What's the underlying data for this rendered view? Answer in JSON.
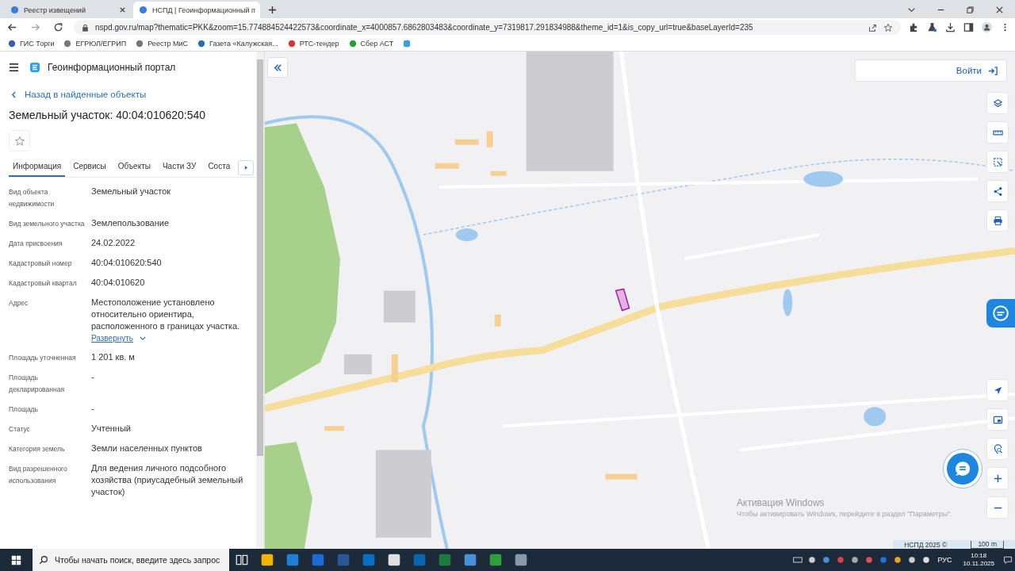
{
  "browser": {
    "tabs": [
      {
        "title": "Реестр извещений",
        "selected": false
      },
      {
        "title": "НСПД | Геоинформационный п",
        "selected": true
      }
    ],
    "url": "nspd.gov.ru/map?thematic=PKK&zoom=15.774884524422573&coordinate_x=4000857.6862803483&coordinate_y=7319817.291834988&theme_id=1&is_copy_url=true&baseLayerId=235",
    "bookmarks": [
      "ГИС Торги",
      "ЕГРЮЛ/ЕГРИП",
      "Реестр МиС",
      "Газета «Калужская...",
      "РТС-тендер",
      "Сбер АСТ"
    ]
  },
  "portal": {
    "title": "Геоинформационный портал",
    "back_link": "Назад в найденные объекты",
    "heading": "Земельный участок: 40:04:010620:540",
    "tabs": [
      {
        "label": "Информация",
        "selected": true
      },
      {
        "label": "Сервисы",
        "selected": false
      },
      {
        "label": "Объекты",
        "selected": false
      },
      {
        "label": "Части ЗУ",
        "selected": false
      },
      {
        "label": "Соста",
        "selected": false
      }
    ],
    "fields": [
      {
        "label": "Вид объекта недвижимости",
        "value": "Земельный участок"
      },
      {
        "label": "Вид земельного участка",
        "value": "Землепользование"
      },
      {
        "label": "Дата присвоения",
        "value": "24.02.2022"
      },
      {
        "label": "Кадастровый номер",
        "value": "40:04:010620:540"
      },
      {
        "label": "Кадастровый квартал",
        "value": "40:04:010620"
      },
      {
        "label": "Адрес",
        "value": "Местоположение установлено относительно ориентира, расположенного в границах участка.",
        "link": "Развернуть"
      },
      {
        "label": "Площадь уточненная",
        "value": "1 201 кв. м"
      },
      {
        "label": "Площадь декларированная",
        "value": "-"
      },
      {
        "label": "Площадь",
        "value": "-"
      },
      {
        "label": "Статус",
        "value": "Учтенный"
      },
      {
        "label": "Категория земель",
        "value": "Земли населенных пунктов"
      },
      {
        "label": "Вид разрешенного использования",
        "value": "Для ведения личного подсобного хозяйства (приусадебный земельный участок)"
      }
    ]
  },
  "map": {
    "login_button": "Войти",
    "attribution": "НСПД 2025 ©",
    "scale": "100 m"
  },
  "windows_activation": {
    "title": "Активация Windows",
    "text": "Чтобы активировать Windows, перейдите в раздел \"Параметры\"."
  },
  "taskbar": {
    "search_placeholder": "Чтобы начать поиск, введите здесь запрос",
    "language": "РУС",
    "time": "10:18",
    "date": "10.11.2025"
  }
}
